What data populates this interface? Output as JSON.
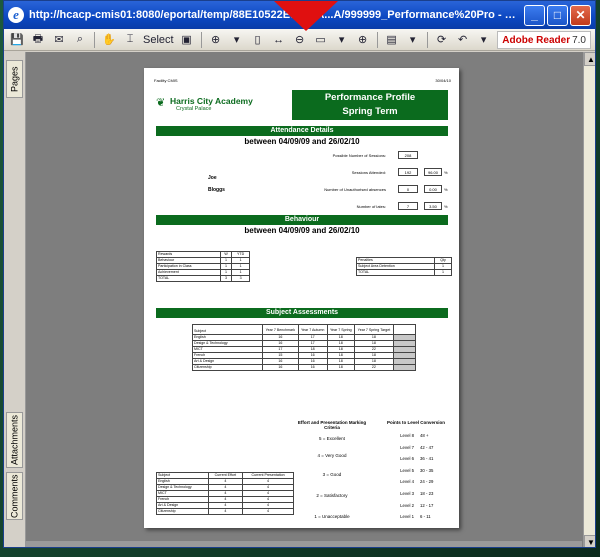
{
  "window": {
    "title": "http://hcacp-cmis01:8080/eportal/temp/88E10522E76C7A...A/999999_Performance%20Pro - Microsoft Inte...",
    "ie_icon": "e",
    "minimize": "_",
    "maximize": "□",
    "close": "✕"
  },
  "toolbar": {
    "select_label": "Select",
    "reader_brand": "Adobe Reader",
    "reader_version": "7.0"
  },
  "left_tabs": [
    "Pages",
    "Attachments",
    "Comments"
  ],
  "report": {
    "school_code": "Facility CMIS",
    "date_top": "30/04/10",
    "logo_line1": "Harris City Academy",
    "logo_line2": "Crystal Palace",
    "title_line1": "Performance Profile",
    "title_line2": "Spring Term",
    "attendance_header": "Attendance Details",
    "attendance_range": "between 04/09/09 and 26/02/10",
    "student_first": "Joe",
    "student_last": "Bloggs",
    "possible_label": "Possible Number of Sessions:",
    "possible_value": "208",
    "attended_label": "Sessions Attended:",
    "attended_value": "192",
    "attended_pct": "96.00",
    "unauth_label": "Number of Unauthorised absences",
    "unauth_value": "0",
    "unauth_pct": "0.00",
    "lates_label": "Number of lates:",
    "lates_value": "7",
    "lates_pct": "3.50",
    "pct_sign": "%",
    "behaviour_header": "Behaviour",
    "behaviour_range": "between 04/09/09 and 26/02/10",
    "rewards_headers": [
      "Rewards",
      "W",
      "YTD"
    ],
    "rewards_rows": [
      [
        "Behaviour",
        "1",
        "1"
      ],
      [
        "Participation in Class",
        "1",
        "1"
      ],
      [
        "Achievement",
        "1",
        "1"
      ],
      [
        "TOTAL",
        "3",
        "3"
      ]
    ],
    "penalties_headers": [
      "Penalties",
      "Qty"
    ],
    "penalties_rows": [
      [
        "Subject Area Detention",
        "1"
      ],
      [
        "TOTAL",
        "1"
      ]
    ],
    "subject_header": "Subject Assessments",
    "subject_cols": [
      "Subject",
      "Year 7 Benchmark",
      "Year 7 Autumn",
      "Year 7 Spring",
      "Year 7 Spring Target",
      ""
    ],
    "subject_rows": [
      [
        "English",
        "16",
        "17",
        "18",
        "18",
        ""
      ],
      [
        "Design & Technology",
        "16",
        "17",
        "18",
        "18",
        ""
      ],
      [
        "MICT",
        "17",
        "18",
        "18",
        "22",
        ""
      ],
      [
        "French",
        "15",
        "16",
        "18",
        "18",
        ""
      ],
      [
        "Art & Design",
        "16",
        "16",
        "18",
        "18",
        ""
      ],
      [
        "Citizenship",
        "16",
        "16",
        "18",
        "22",
        ""
      ]
    ],
    "effort_title": "Effort and Presentation Marking Criteria",
    "effort_items": [
      "5 = Excellent",
      "4 = Very Good",
      "3 = Good",
      "2 = Satisfactory",
      "1 = Unacceptable"
    ],
    "points_title": "Points to Level Conversion",
    "points_rows": [
      [
        "Level 8",
        "48 +"
      ],
      [
        "Level 7",
        "42 - 47"
      ],
      [
        "Level 6",
        "36 - 41"
      ],
      [
        "Level 5",
        "30 - 35"
      ],
      [
        "Level 4",
        "24 - 29"
      ],
      [
        "Level 3",
        "18 - 23"
      ],
      [
        "Level 2",
        "12 - 17"
      ],
      [
        "Level 1",
        "6 - 11"
      ]
    ],
    "effort_table_headers": [
      "Subject",
      "Current Effort",
      "Current Presentation"
    ],
    "effort_table_rows": [
      [
        "English",
        "4",
        "4"
      ],
      [
        "Design & Technology",
        "4",
        "4"
      ],
      [
        "MICT",
        "4",
        "4"
      ],
      [
        "French",
        "4",
        "4"
      ],
      [
        "Art & Design",
        "4",
        "4"
      ],
      [
        "Citizenship",
        "4",
        "4"
      ]
    ]
  },
  "colors": {
    "report_green": "#0b6b1e",
    "titlebar_blue": "#0b47c1",
    "arrow_red": "#e01010"
  }
}
